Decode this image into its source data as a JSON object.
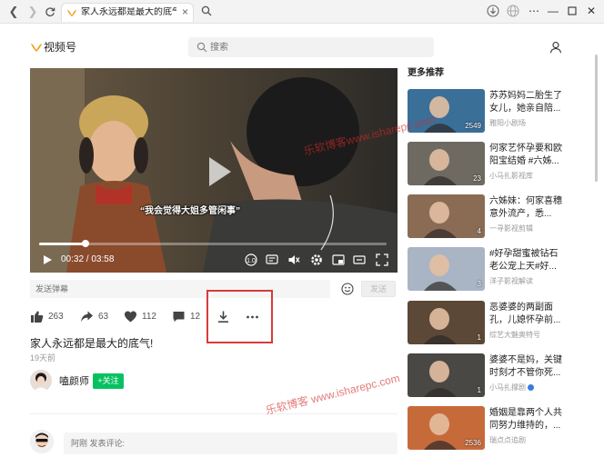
{
  "browser": {
    "tab_title": "家人永远都是最大的底气!",
    "tab_close": "×"
  },
  "header": {
    "logo_text": "视频号",
    "search_placeholder": "搜索"
  },
  "player": {
    "subtitle": "“我会觉得大姐多管闲事”",
    "current_time": "00:32",
    "duration": "03:58",
    "time_display": "00:32 / 03:58",
    "progress_fraction": 0.134
  },
  "danmu": {
    "placeholder": "发送弹幕",
    "send_label": "发送"
  },
  "actions": {
    "likes": "263",
    "shares": "63",
    "favorites": "112",
    "comments": "12"
  },
  "video": {
    "title": "家人永远都是最大的底气!",
    "date": "19天前",
    "author": "嗑颜师",
    "follow_label": "+关注"
  },
  "comment": {
    "placeholder": "阿刚 发表评论:"
  },
  "sidebar": {
    "title": "更多推荐",
    "items": [
      {
        "title": "苏苏妈妈二胎生了女儿，她亲自陪...",
        "author": "雅阳小剧场",
        "likes": "2549",
        "verified": false,
        "thumb_color": "#3a6f98"
      },
      {
        "title": "何家艺怀孕要和欧阳宝结婚 #六姊...",
        "author": "小马扎影视库",
        "likes": "23",
        "verified": false,
        "thumb_color": "#6e6a62"
      },
      {
        "title": "六姊妹：何家喜穗意外流产，悉...",
        "author": "一寻影视剪辑",
        "likes": "4",
        "verified": false,
        "thumb_color": "#8a6c55"
      },
      {
        "title": "#好孕甜蜜被钻石老公宠上天#好...",
        "author": "洋子影视解读",
        "likes": "3",
        "verified": false,
        "thumb_color": "#a9b4c4"
      },
      {
        "title": "恶婆婆的两副面孔，儿媳怀孕前...",
        "author": "综艺大魅奥特号",
        "likes": "1",
        "verified": false,
        "thumb_color": "#5b4836"
      },
      {
        "title": "婆婆不是妈，关键时刻才不管你死...",
        "author": "小马扎撑剧",
        "likes": "1",
        "verified": true,
        "thumb_color": "#4a4844"
      },
      {
        "title": "婚姻是靠两个人共同努力维持的，...",
        "author": "瑞点点追剧",
        "likes": "2536",
        "verified": false,
        "thumb_color": "#c76a3a"
      }
    ]
  },
  "watermarks": [
    "乐软博客www.isharepc.com",
    "乐软博客 www.isharepc.com"
  ]
}
